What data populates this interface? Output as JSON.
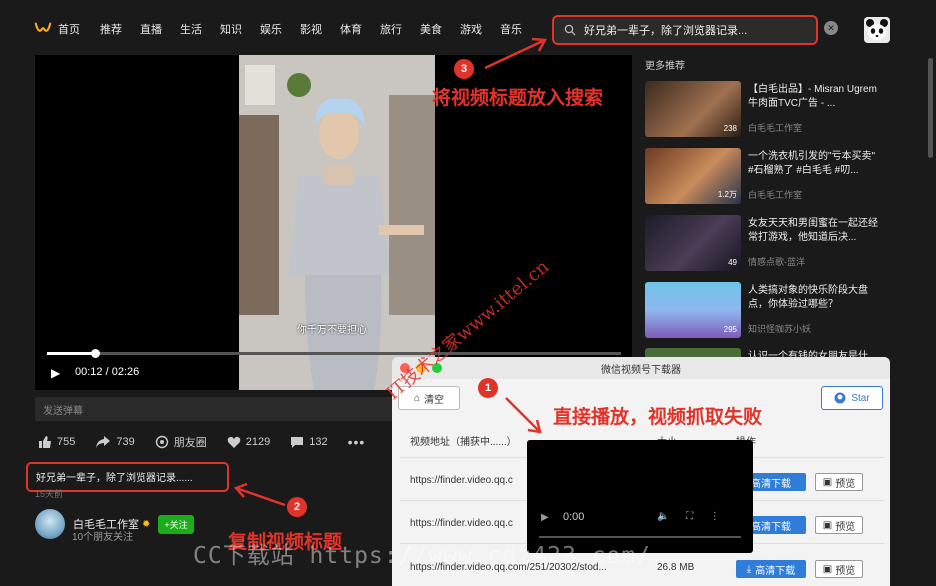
{
  "nav": {
    "items": [
      "首页",
      "推荐",
      "直播",
      "生活",
      "知识",
      "娱乐",
      "影视",
      "体育",
      "旅行",
      "美食",
      "游戏",
      "音乐"
    ]
  },
  "search": {
    "value": "好兄弟一辈子，除了浏览器记录..."
  },
  "player": {
    "current_time": "00:12",
    "duration": "02:26",
    "progress": 0.084,
    "subtitle": "你千万不要担心"
  },
  "danmu_placeholder": "发送弹幕",
  "actions": {
    "likes": "755",
    "shares": "739",
    "moments": "朋友圈",
    "favorites": "2129",
    "comments": "132"
  },
  "video_title": "好兄弟一辈子，除了浏览器记录......",
  "time_ago": "15天前",
  "author": {
    "name": "白毛毛工作室",
    "follow": "+关注",
    "friends": "10个朋友关注"
  },
  "recommend": {
    "title": "更多推荐",
    "items": [
      {
        "text": "【白毛出品】- Misran Ugrem 牛肉面TVC广告 - ...",
        "author": "白毛毛工作室",
        "stat": "238"
      },
      {
        "text": "一个洗衣机引发的\"亏本买卖\" #石榴熟了 #白毛毛 #叨...",
        "author": "白毛毛工作室",
        "stat": "1.2万"
      },
      {
        "text": "女友天天和男闺蜜在一起还经常打游戏，他知道后决...",
        "author": "情感点歌-蓝洋",
        "stat": "49"
      },
      {
        "text": "人类搞对象的快乐阶段大盘点，你体验过哪些？",
        "author": "知识怪咖苏小妖",
        "stat": "295"
      },
      {
        "text": "认识一个有钱的女朋友是什",
        "author": "",
        "stat": ""
      }
    ]
  },
  "downloader": {
    "title": "微信视频号下载器",
    "clear": "清空",
    "star": "Star",
    "col_url": "视频地址（捕获中......）",
    "col_size": "大小",
    "col_action": "操作",
    "rows": [
      {
        "url": "https://finder.video.qq.c",
        "size": "",
        "download": "高清下载",
        "preview": "预览"
      },
      {
        "url": "https://finder.video.qq.c",
        "size": "",
        "download": "高清下载",
        "preview": "预览"
      },
      {
        "url": "https://finder.video.qq.com/251/20302/stod...",
        "size": "26.8 MB",
        "download": "高清下载",
        "preview": "预览"
      }
    ],
    "mini_time": "0:00"
  },
  "annotations": {
    "step1": "直接播放，视频抓取失败",
    "step2": "复制视频标题",
    "step3": "将视频标题放入搜索",
    "badge1": "1",
    "badge2": "2",
    "badge3": "3",
    "watermark": "IT技术之家www.ittel.cn",
    "watermark2": "CC下载站 https://www.cdz423.com/"
  },
  "colors": {
    "accent_red": "#e0332a",
    "follow_green": "#1aad19",
    "download_blue": "#2f7cd9"
  }
}
